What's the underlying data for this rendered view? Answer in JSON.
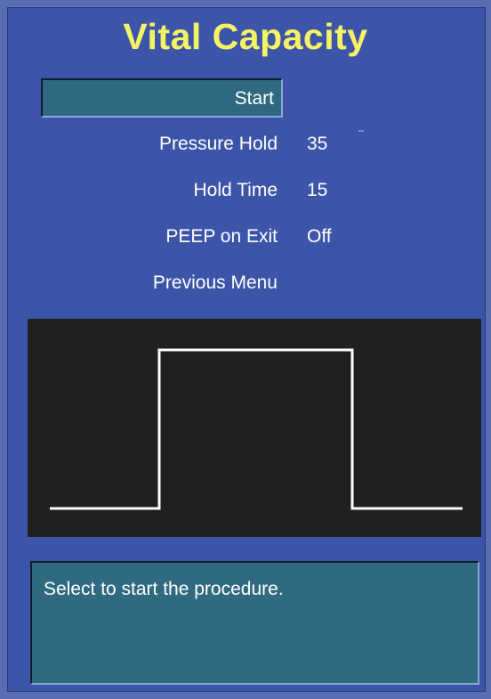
{
  "title": "Vital Capacity",
  "menu": {
    "start_label": "Start",
    "items": [
      {
        "label": "Pressure Hold",
        "value": "35"
      },
      {
        "label": "Hold Time",
        "value": "15"
      },
      {
        "label": "PEEP on Exit",
        "value": "Off"
      },
      {
        "label": "Previous Menu",
        "value": ""
      }
    ]
  },
  "waveform": {
    "type": "pressure-square-wave",
    "line_color": "#ffffff",
    "background_color": "#221f20"
  },
  "info": {
    "message": "Select to start the procedure."
  },
  "colors": {
    "title": "#f5f266",
    "panel": "#3d55a9",
    "selected_button": "#2f6881",
    "info_box": "#2f6a80"
  }
}
